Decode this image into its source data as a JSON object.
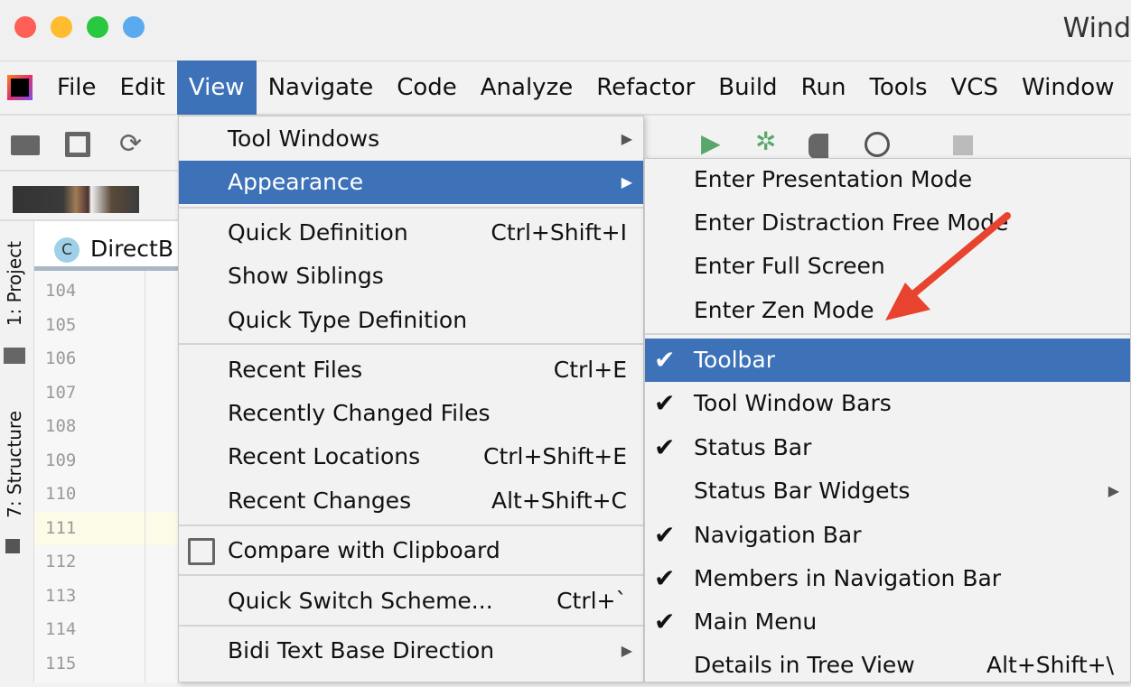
{
  "window": {
    "title": "Wind"
  },
  "menubar": [
    "File",
    "Edit",
    "View",
    "Navigate",
    "Code",
    "Analyze",
    "Refactor",
    "Build",
    "Run",
    "Tools",
    "VCS",
    "Window"
  ],
  "tab": {
    "label": "DirectB",
    "icon": "C"
  },
  "side": {
    "project": "1: Project",
    "structure": "7: Structure"
  },
  "lines": [
    "104",
    "105",
    "106",
    "107",
    "108",
    "109",
    "110",
    "111",
    "112",
    "113",
    "114",
    "115"
  ],
  "view_menu": [
    {
      "label": "Tool Windows",
      "submenu": true
    },
    {
      "label": "Appearance",
      "submenu": true,
      "highlighted": true
    },
    {
      "label": "Quick Definition",
      "shortcut": "Ctrl+Shift+I"
    },
    {
      "label": "Show Siblings"
    },
    {
      "label": "Quick Type Definition"
    },
    {
      "label": "Recent Files",
      "shortcut": "Ctrl+E"
    },
    {
      "label": "Recently Changed Files"
    },
    {
      "label": "Recent Locations",
      "shortcut": "Ctrl+Shift+E"
    },
    {
      "label": "Recent Changes",
      "shortcut": "Alt+Shift+C"
    },
    {
      "label": "Compare with Clipboard"
    },
    {
      "label": "Quick Switch Scheme...",
      "shortcut": "Ctrl+`"
    },
    {
      "label": "Bidi Text Base Direction",
      "submenu": true
    }
  ],
  "appearance_menu": [
    {
      "label": "Enter Presentation Mode"
    },
    {
      "label": "Enter Distraction Free Mode"
    },
    {
      "label": "Enter Full Screen"
    },
    {
      "label": "Enter Zen Mode"
    },
    {
      "label": "Toolbar",
      "checked": true,
      "highlighted": true
    },
    {
      "label": "Tool Window Bars",
      "checked": true
    },
    {
      "label": "Status Bar",
      "checked": true
    },
    {
      "label": "Status Bar Widgets",
      "submenu": true
    },
    {
      "label": "Navigation Bar",
      "checked": true
    },
    {
      "label": "Members in Navigation Bar",
      "checked": true
    },
    {
      "label": "Main Menu",
      "checked": true
    },
    {
      "label": "Details in Tree View",
      "shortcut": "Alt+Shift+\\"
    }
  ],
  "colors": {
    "accent": "#3d72b9",
    "arrow": "#e8432e"
  }
}
